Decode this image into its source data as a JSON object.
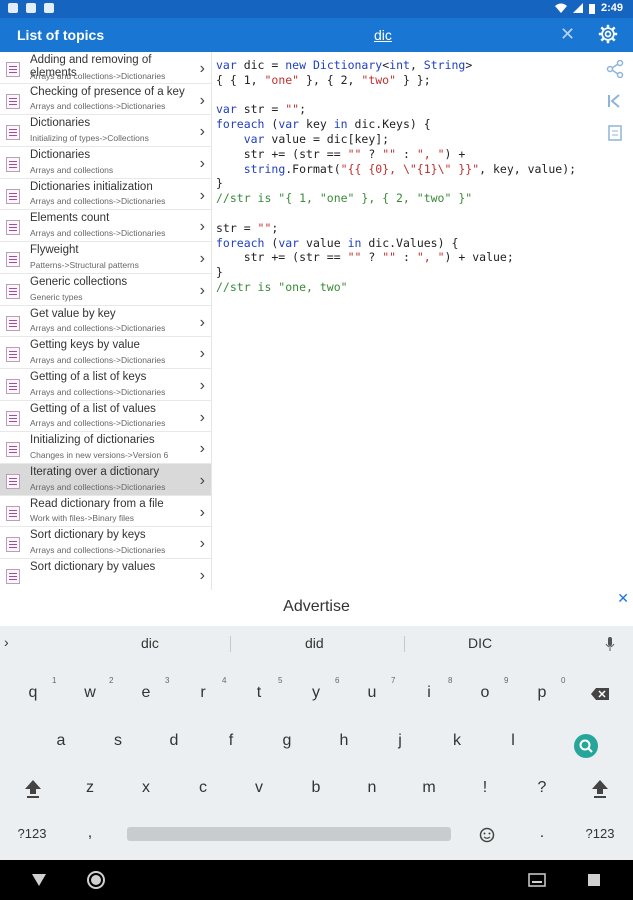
{
  "status_bar": {
    "time": "2:49"
  },
  "app_bar": {
    "title": "List of topics",
    "search_query": "dic",
    "close_glyph": "✕",
    "settings_icon": "gear-icon"
  },
  "topics": [
    {
      "title": "Adding and removing of elements",
      "subtitle": "Arrays and collections->Dictionaries"
    },
    {
      "title": "Checking of presence of a key",
      "subtitle": "Arrays and collections->Dictionaries"
    },
    {
      "title": "Dictionaries",
      "subtitle": "Initializing of types->Collections"
    },
    {
      "title": "Dictionaries",
      "subtitle": "Arrays and collections"
    },
    {
      "title": "Dictionaries initialization",
      "subtitle": "Arrays and collections->Dictionaries"
    },
    {
      "title": "Elements count",
      "subtitle": "Arrays and collections->Dictionaries"
    },
    {
      "title": "Flyweight",
      "subtitle": "Patterns->Structural patterns"
    },
    {
      "title": "Generic collections",
      "subtitle": "Generic types"
    },
    {
      "title": "Get value by key",
      "subtitle": "Arrays and collections->Dictionaries"
    },
    {
      "title": "Getting keys by value",
      "subtitle": "Arrays and collections->Dictionaries"
    },
    {
      "title": "Getting of a list of keys",
      "subtitle": "Arrays and collections->Dictionaries"
    },
    {
      "title": "Getting of a list of values",
      "subtitle": "Arrays and collections->Dictionaries"
    },
    {
      "title": "Initializing of dictionaries",
      "subtitle": "Changes in new versions->Version 6"
    },
    {
      "title": "Iterating over a dictionary",
      "subtitle": "Arrays and collections->Dictionaries"
    },
    {
      "title": "Read dictionary from a file",
      "subtitle": "Work with files->Binary files"
    },
    {
      "title": "Sort dictionary by keys",
      "subtitle": "Arrays and collections->Dictionaries"
    },
    {
      "title": "Sort dictionary by values",
      "subtitle": ""
    }
  ],
  "advertise": {
    "label": "Advertise",
    "close_glyph": "✕"
  },
  "suggestions": [
    "dic",
    "did",
    "DIC"
  ],
  "keyboard": {
    "row1": [
      "q",
      "w",
      "e",
      "r",
      "t",
      "y",
      "u",
      "i",
      "o",
      "p"
    ],
    "row1_hints": [
      "1",
      "2",
      "3",
      "4",
      "5",
      "6",
      "7",
      "8",
      "9",
      "0"
    ],
    "row2": [
      "a",
      "s",
      "d",
      "f",
      "g",
      "h",
      "j",
      "k",
      "l"
    ],
    "row3": [
      "z",
      "x",
      "c",
      "v",
      "b",
      "n",
      "m",
      "!",
      "?"
    ],
    "symbols_key": "?123",
    "comma_key": ",",
    "period_key": ".",
    "symbols_key_right": "?123"
  }
}
